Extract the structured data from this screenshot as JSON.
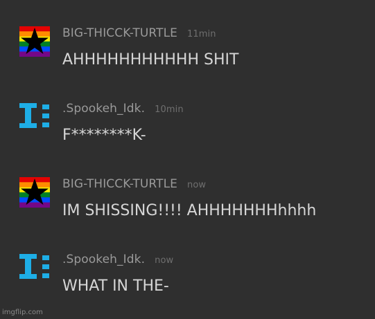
{
  "messages": [
    {
      "avatar": "rainbow-star-icon",
      "username": "BIG-THICCK-TURTLE",
      "time": "11min",
      "text": "AHHHHHHHHHHH SHIT"
    },
    {
      "avatar": "blue-i-logo-icon",
      "username": ".Spookeh_Idk.",
      "time": "10min",
      "text": "F********K-"
    },
    {
      "avatar": "rainbow-star-icon",
      "username": "BIG-THICCK-TURTLE",
      "time": "now",
      "text": "IM SHISSING!!!! AHHHHHHHhhhh"
    },
    {
      "avatar": "blue-i-logo-icon",
      "username": ".Spookeh_Idk.",
      "time": "now",
      "text": "WHAT IN THE-"
    }
  ],
  "watermark": "imgflip.com",
  "colors": {
    "background": "#2f2f2f",
    "username": "#9a9a9a",
    "timestamp": "#6f6f6f",
    "message_text": "#d6d6d6",
    "logo_blue": "#1eaee6"
  }
}
